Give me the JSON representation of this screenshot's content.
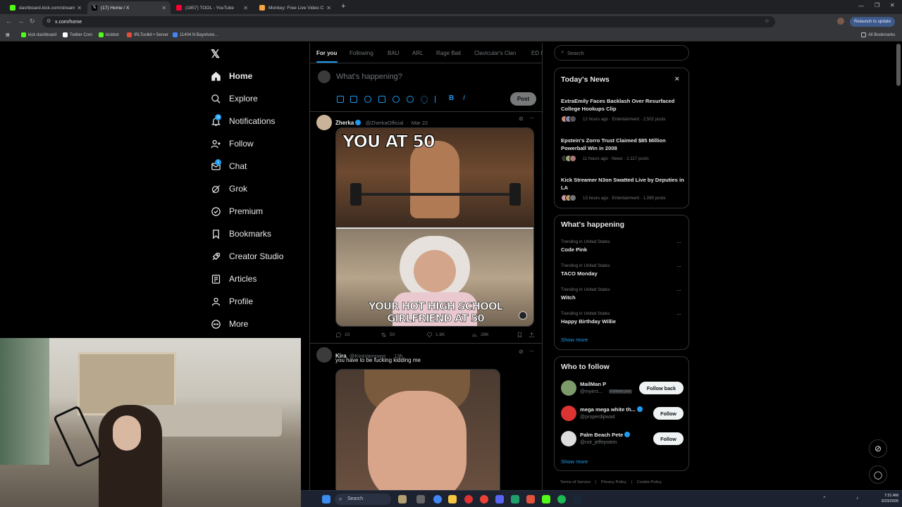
{
  "browser": {
    "tabs": [
      {
        "title": "dashboard.kick.com/stream",
        "color": "#53fc18"
      },
      {
        "title": "(17) Home / X",
        "color": "#ffffff",
        "active": true
      },
      {
        "title": "(1857) TOOL - YouTube",
        "color": "#ff0033"
      },
      {
        "title": "Monkey: Free Live Video C",
        "color": "#f7a441"
      }
    ],
    "url": "x.com/home",
    "relaunch_label": "Relaunch to update",
    "bookmarks": [
      "kick dashboard",
      "Twitter Com",
      "kickbot",
      "IRLToolkit • Server",
      "11404 N Bayshore...",
      "All Bookmarks"
    ]
  },
  "nav": {
    "items": [
      {
        "label": "Home",
        "icon": "home-icon"
      },
      {
        "label": "Explore",
        "icon": "search-icon"
      },
      {
        "label": "Notifications",
        "icon": "bell-icon",
        "badge": "16"
      },
      {
        "label": "Follow",
        "icon": "person-add-icon"
      },
      {
        "label": "Chat",
        "icon": "mail-icon",
        "badge": "1"
      },
      {
        "label": "Grok",
        "icon": "grok-icon"
      },
      {
        "label": "Premium",
        "icon": "premium-icon"
      },
      {
        "label": "Bookmarks",
        "icon": "bookmark-icon"
      },
      {
        "label": "Creator Studio",
        "icon": "rocket-icon"
      },
      {
        "label": "Articles",
        "icon": "article-icon"
      },
      {
        "label": "Profile",
        "icon": "person-icon"
      },
      {
        "label": "More",
        "icon": "more-icon"
      }
    ]
  },
  "timeline": {
    "tabs": [
      "For you",
      "Following",
      "BAU",
      "ARL",
      "Rage Bait",
      "Clavicular's Clan",
      "ED I"
    ],
    "compose_placeholder": "What's happening?",
    "post_label": "Post",
    "tweets": [
      {
        "name": "Zherka",
        "handle": "@ZherkaOfficial",
        "time": "Mar 22",
        "meme_top": "YOU AT 50",
        "meme_bottom": "YOUR HOT HIGH SCHOOL GIRLFRIEND AT 50",
        "replies": "10",
        "reposts": "50",
        "likes": "1.6K",
        "views": "28K"
      },
      {
        "name": "Kira",
        "handle": "@KiraVampwyr",
        "time": "13h",
        "text": "you have to be fucking kidding me"
      }
    ]
  },
  "right": {
    "search_placeholder": "Search",
    "news": {
      "title": "Today's News",
      "items": [
        {
          "headline": "ExtraEmily Faces Backlash Over Resurfaced College Hookups Clip",
          "meta": "12 hours ago · Entertainment · 2,502 posts"
        },
        {
          "headline": "Epstein's Zorro Trust Claimed $85 Million Powerball Win in 2008",
          "meta": "11 hours ago · News · 2,117 posts"
        },
        {
          "headline": "Kick Streamer N3on Swatted Live by Deputies in LA",
          "meta": "13 hours ago · Entertainment · 1,080 posts"
        }
      ]
    },
    "happening": {
      "title": "What's happening",
      "items": [
        {
          "context": "Trending in United States",
          "name": "Code Pink"
        },
        {
          "context": "Trending in United States",
          "name": "TACO Monday"
        },
        {
          "context": "Trending in United States",
          "name": "Witch"
        },
        {
          "context": "Trending in United States",
          "name": "Happy Birthday Willie"
        }
      ],
      "show_more": "Show more"
    },
    "who_to_follow": {
      "title": "Who to follow",
      "accounts": [
        {
          "name": "MailMan P",
          "handle": "@myers...",
          "tag": "Follows you",
          "button": "Follow back"
        },
        {
          "name": "mega mega white th...",
          "handle": "@properdipwad",
          "button": "Follow"
        },
        {
          "name": "Palm Beach Pete",
          "handle": "@not_jeffepstein",
          "button": "Follow"
        }
      ],
      "show_more": "Show more"
    },
    "footer": [
      "Terms of Service",
      "Privacy Policy",
      "Cookie Policy"
    ]
  },
  "taskbar": {
    "search_label": "Search",
    "time": "7:31 AM",
    "date": "3/23/2026"
  }
}
